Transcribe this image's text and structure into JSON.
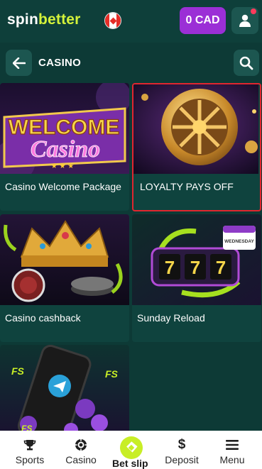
{
  "header": {
    "logo_part1": "spin",
    "logo_part2": "better",
    "balance": "0 CAD"
  },
  "subheader": {
    "title": "CASINO"
  },
  "promos": [
    {
      "label": "Casino Welcome Package",
      "image_text_1": "WELCOME",
      "image_text_2": "Casino"
    },
    {
      "label": "LOYALTY PAYS OFF"
    },
    {
      "label": "Casino cashback"
    },
    {
      "label": "Sunday Reload",
      "image_text_1": "WEDNESDAY"
    },
    {
      "label": "",
      "image_text_1": "FS"
    }
  ],
  "bottom_nav": {
    "items": [
      {
        "label": "Sports",
        "icon": "trophy-icon"
      },
      {
        "label": "Casino",
        "icon": "casino-chip-icon"
      },
      {
        "label": "Bet slip",
        "icon": "ticket-icon"
      },
      {
        "label": "Deposit",
        "icon": "dollar-icon"
      },
      {
        "label": "Menu",
        "icon": "hamburger-icon"
      }
    ]
  },
  "colors": {
    "background": "#0d3a36",
    "accent_lime": "#d4f23a",
    "balance_purple": "#9b2fd6",
    "selected_border": "#e0262f"
  }
}
